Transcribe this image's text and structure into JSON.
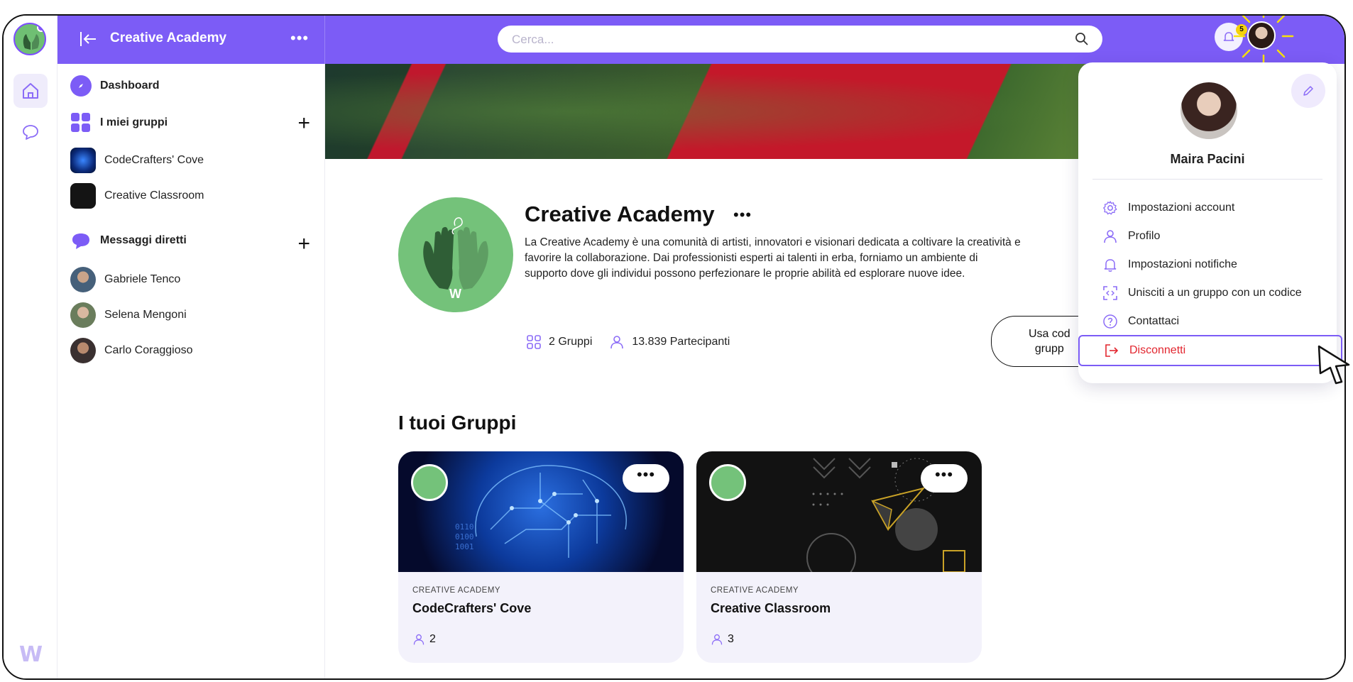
{
  "colors": {
    "accent": "#7c5cf6",
    "logout": "#e2262f",
    "badge": "#f5d20b"
  },
  "topbar": {
    "back_icon": "collapse-left-icon",
    "title": "Creative Academy",
    "more": "•••",
    "search_placeholder": "Cerca...",
    "notification_count": "5"
  },
  "nav": {
    "dashboard": "Dashboard",
    "groups_header": "I miei gruppi",
    "groups": [
      {
        "label": "CodeCrafters' Cove"
      },
      {
        "label": "Creative Classroom"
      }
    ],
    "dm_header": "Messaggi diretti",
    "contacts": [
      {
        "label": "Gabriele Tenco"
      },
      {
        "label": "Selena Mengoni"
      },
      {
        "label": "Carlo Coraggioso"
      }
    ],
    "plus": "+"
  },
  "main": {
    "title": "Creative Academy",
    "title_more": "•••",
    "logo_letter": "W",
    "description": "La Creative Academy è una comunità di artisti, innovatori e visionari dedicata a coltivare la creatività e favorire la collaborazione. Dai professionisti esperti ai talenti in erba, forniamo un ambiente di supporto dove gli individui possono perfezionare le proprie abilità ed esplorare nuove idee.",
    "stats": {
      "groups": "2 Gruppi",
      "members": "13.839 Partecipanti"
    },
    "code_button": "Usa cod\ngrupp",
    "section_title": "I tuoi Gruppi",
    "cards": [
      {
        "org": "CREATIVE ACADEMY",
        "name": "CodeCrafters' Cove",
        "members": "2",
        "more": "•••"
      },
      {
        "org": "CREATIVE ACADEMY",
        "name": "Creative Classroom",
        "members": "3",
        "more": "•••"
      }
    ]
  },
  "dropdown": {
    "user_name": "Maira Pacini",
    "items": [
      {
        "label": "Impostazioni account",
        "icon": "gear-icon"
      },
      {
        "label": "Profilo",
        "icon": "user-icon"
      },
      {
        "label": "Impostazioni notifiche",
        "icon": "bell-icon"
      },
      {
        "label": "Unisciti a un gruppo con un codice",
        "icon": "scan-code-icon"
      },
      {
        "label": "Contattaci",
        "icon": "help-icon"
      }
    ],
    "logout": "Disconnetti"
  },
  "rail": {
    "logo": "W"
  }
}
